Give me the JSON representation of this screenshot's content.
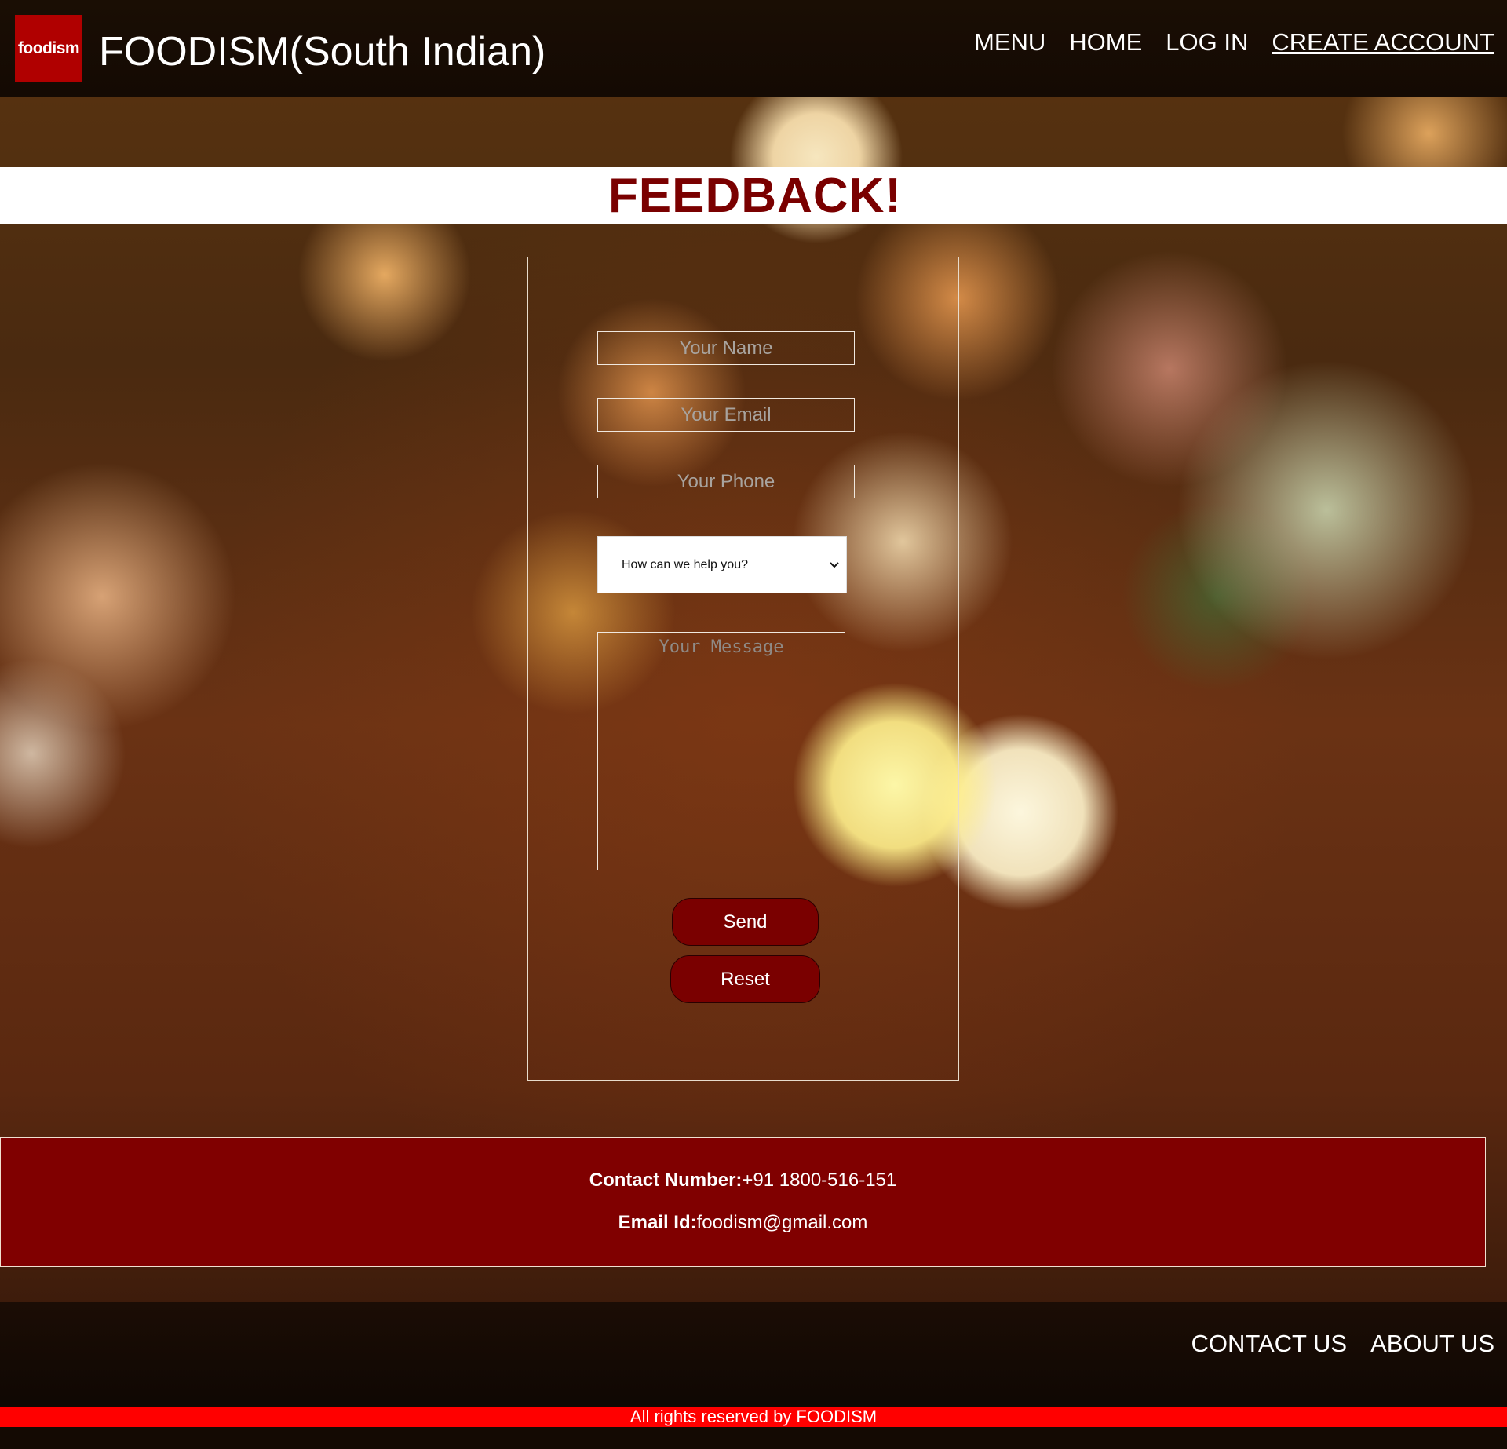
{
  "header": {
    "logo_text": "foodism",
    "site_title": "FOODISM(South Indian)",
    "nav": {
      "menu": "MENU",
      "home": "HOME",
      "login": "LOG IN",
      "create_account": "CREATE ACCOUNT"
    }
  },
  "page_heading": "FEEDBACK!",
  "form": {
    "name_placeholder": "Your Name",
    "email_placeholder": "Your Email",
    "phone_placeholder": "Your Phone",
    "help_select_value": "How can we help you?",
    "message_placeholder": "Your Message",
    "send_label": "Send",
    "reset_label": "Reset"
  },
  "contact": {
    "number_label": "Contact Number:",
    "number_value": "+91 1800-516-151",
    "email_label": "Email Id:",
    "email_value": "foodism@gmail.com"
  },
  "footer": {
    "contact_us": "CONTACT US",
    "about_us": "ABOUT US",
    "copyright": "All rights reserved by FOODISM"
  },
  "colors": {
    "brand_red": "#7a0000",
    "contact_band": "#800000",
    "copyright_bar": "#ff0000",
    "logo_bg": "#b00000"
  },
  "icons": {
    "select_chevron": "chevron-down-icon"
  }
}
